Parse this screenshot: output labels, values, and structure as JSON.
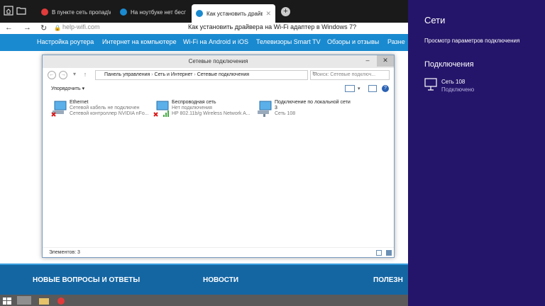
{
  "browser": {
    "tabs": [
      {
        "label": "В пункте сеть пропад\\ка в",
        "favicon_color": "#e23b3b"
      },
      {
        "label": "На ноутбуке нет беспровод",
        "favicon_color": "#1a8ad0"
      },
      {
        "label": "Как установить драйвер",
        "favicon_color": "#1a8ad0"
      }
    ],
    "new_tab": "+",
    "url": "help-wifi.com",
    "page_title": "Как установить драйвера на Wi-Fi адаптер в Windows 7?"
  },
  "site_nav": {
    "items": [
      "Настройка роутера",
      "Интернет на компьютере",
      "Wi-Fi на Android и iOS",
      "Телевизоры Smart TV",
      "Обзоры и отзывы",
      "Разне"
    ]
  },
  "footer": {
    "headings": [
      "НОВЫЕ ВОПРОСЫ И ОТВЕТЫ",
      "НОВОСТИ",
      "ПОЛЕЗН"
    ]
  },
  "explorer": {
    "title": "Сетевые подключения",
    "breadcrumb": [
      "Панель управления",
      "Сеть и Интернет",
      "Сетевые подключения"
    ],
    "search_placeholder": "Поиск: Сетевые подключ...",
    "organize": "Упорядочить",
    "connections": [
      {
        "name": "Ethernet",
        "status": "Сетевой кабель не подключен",
        "device": "Сетевой контроллер NVIDIA nFo..."
      },
      {
        "name": "Беспроводная сеть",
        "status": "Нет подключения",
        "device": "HP 802.11b/g Wireless Network A..."
      },
      {
        "name": "Подключение по локальной сети",
        "name2": "3",
        "status": "Сеть  108"
      }
    ],
    "status_bar": "Элементов: 3"
  },
  "charm": {
    "title": "Сети",
    "view_settings": "Просмотр параметров подключения",
    "section": "Подключения",
    "network": {
      "name": "Сеть  108",
      "status": "Подключено"
    }
  }
}
